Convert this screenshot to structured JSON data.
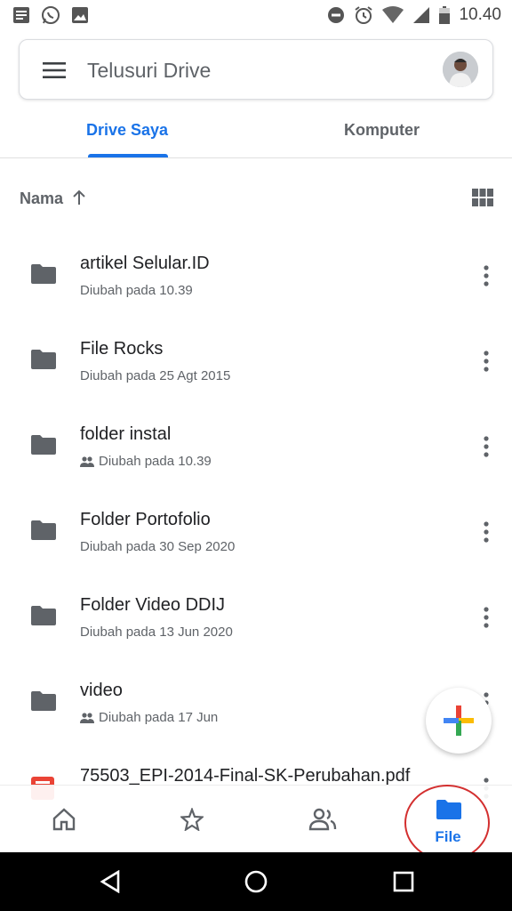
{
  "statusbar": {
    "time": "10.40",
    "left_icons": [
      "message-icon",
      "whatsapp-icon",
      "image-icon"
    ],
    "right_icons": [
      "do-not-disturb-icon",
      "alarm-icon",
      "wifi-icon",
      "signal-icon",
      "battery-icon"
    ]
  },
  "search": {
    "placeholder": "Telusuri Drive",
    "menu_icon": "menu-icon",
    "avatar": "avatar"
  },
  "tabs": [
    {
      "label": "Drive Saya",
      "active": true
    },
    {
      "label": "Komputer",
      "active": false
    }
  ],
  "sort": {
    "label": "Nama",
    "direction_icon": "arrow-up-icon",
    "view_icon": "grid-view-icon"
  },
  "files": [
    {
      "name": "artikel Selular.ID",
      "meta": "Diubah pada 10.39",
      "shared": false,
      "type": "folder"
    },
    {
      "name": "File Rocks",
      "meta": "Diubah pada 25 Agt 2015",
      "shared": false,
      "type": "folder"
    },
    {
      "name": "folder instal",
      "meta": "Diubah pada 10.39",
      "shared": true,
      "type": "folder"
    },
    {
      "name": "Folder Portofolio",
      "meta": "Diubah pada 30 Sep 2020",
      "shared": false,
      "type": "folder"
    },
    {
      "name": "Folder Video DDIJ",
      "meta": "Diubah pada 13 Jun 2020",
      "shared": false,
      "type": "folder"
    },
    {
      "name": "video",
      "meta": "Diubah pada 17 Jun",
      "shared": true,
      "type": "folder"
    },
    {
      "name": "75503_EPI-2014-Final-SK-Perubahan.pdf",
      "meta": "",
      "shared": false,
      "type": "pdf"
    }
  ],
  "fab": {
    "icon": "plus-icon"
  },
  "bottom_nav": [
    {
      "icon": "home-icon",
      "label": ""
    },
    {
      "icon": "star-icon",
      "label": ""
    },
    {
      "icon": "shared-people-icon",
      "label": ""
    },
    {
      "icon": "folder-icon",
      "label": "File",
      "active": true
    }
  ],
  "colors": {
    "accent": "#1a73e8",
    "text_primary": "#202124",
    "text_secondary": "#5f6368",
    "folder": "#5f6368",
    "annotation": "#d32f2f"
  }
}
